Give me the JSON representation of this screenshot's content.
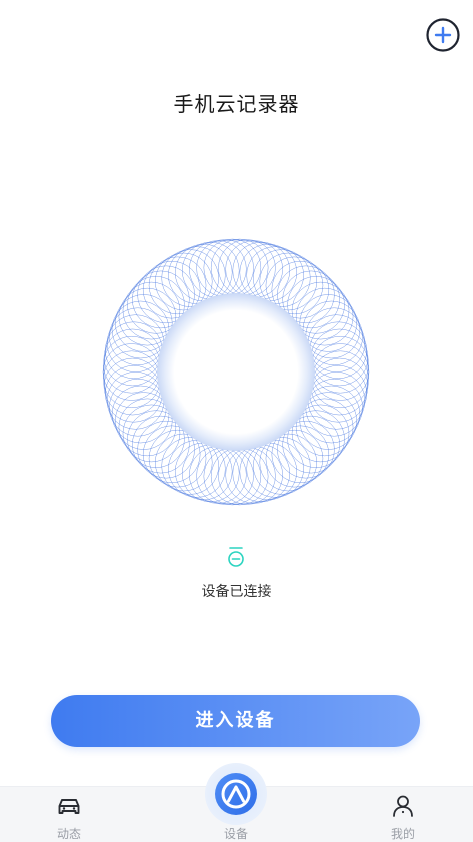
{
  "header": {
    "title": "手机云记录器",
    "add_icon": "plus-circle-icon"
  },
  "device": {
    "status_icon": "device-connected-icon",
    "status_text": "设备已连接"
  },
  "actions": {
    "enter_label": "进入设备"
  },
  "tabbar": {
    "tabs": [
      {
        "label": "动态",
        "icon": "car-icon"
      },
      {
        "label": "设备",
        "icon": "device-logo-icon"
      },
      {
        "label": "我的",
        "icon": "person-icon"
      }
    ]
  },
  "colors": {
    "accent": "#3f7bf0",
    "accent_light": "#78a4f8",
    "status": "#2bd4c0",
    "ring": "#4a78e0"
  }
}
